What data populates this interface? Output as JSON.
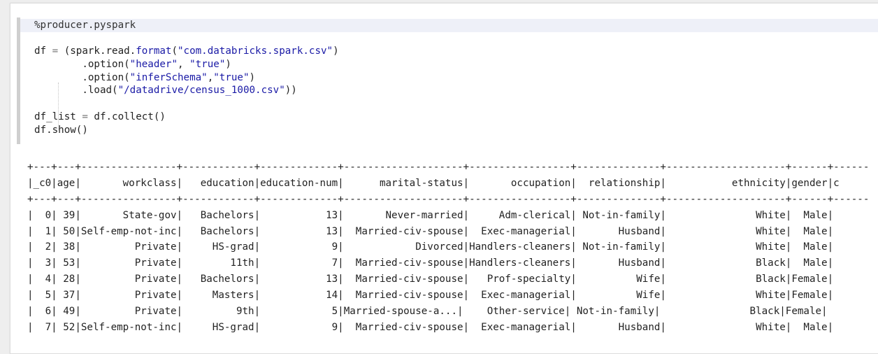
{
  "code": {
    "magic": "%producer.pyspark",
    "line_read": {
      "lhs": "df ",
      "eq": "=",
      "mid": " (spark.read.",
      "fn": "format",
      "open": "(",
      "str": "\"com.databricks.spark.csv\"",
      "close": ")"
    },
    "line_header": {
      "pre": "        .option(",
      "s1": "\"header\"",
      "sep": ", ",
      "s2": "\"true\"",
      "post": ")"
    },
    "line_infer": {
      "pre": "        .option(",
      "s1": "\"inferSchema\"",
      "sep": ",",
      "s2": "\"true\"",
      "post": ")"
    },
    "line_load": {
      "pre": "        .load(",
      "s1": "\"/datadrive/census_1000.csv\"",
      "post": "))"
    },
    "line_collect": {
      "lhs": "df_list ",
      "eq": "=",
      "rhs": " df.collect()"
    },
    "line_show": "df.show()"
  },
  "output": {
    "border": "+---+---+----------------+------------+-------------+--------------------+-----------------+--------------+--------------------+------+------",
    "header": "|_c0|age|       workclass|   education|education-num|      marital-status|       occupation|  relationship|           ethnicity|gender|c",
    "rows": [
      "|  0| 39|       State-gov|   Bachelors|           13|       Never-married|     Adm-clerical| Not-in-family|               White|  Male|",
      "|  1| 50|Self-emp-not-inc|   Bachelors|           13|  Married-civ-spouse|  Exec-managerial|       Husband|               White|  Male|",
      "|  2| 38|         Private|     HS-grad|            9|            Divorced|Handlers-cleaners| Not-in-family|               White|  Male|",
      "|  3| 53|         Private|        11th|            7|  Married-civ-spouse|Handlers-cleaners|       Husband|               Black|  Male|",
      "|  4| 28|         Private|   Bachelors|           13|  Married-civ-spouse|   Prof-specialty|          Wife|               Black|Female|",
      "|  5| 37|         Private|     Masters|           14|  Married-civ-spouse|  Exec-managerial|          Wife|               White|Female|",
      "|  6| 49|         Private|         9th|            5|Married-spouse-a...|    Other-service| Not-in-family|               Black|Female|",
      "|  7| 52|Self-emp-not-inc|     HS-grad|            9|  Married-civ-spouse|  Exec-managerial|       Husband|               White|  Male|"
    ]
  }
}
